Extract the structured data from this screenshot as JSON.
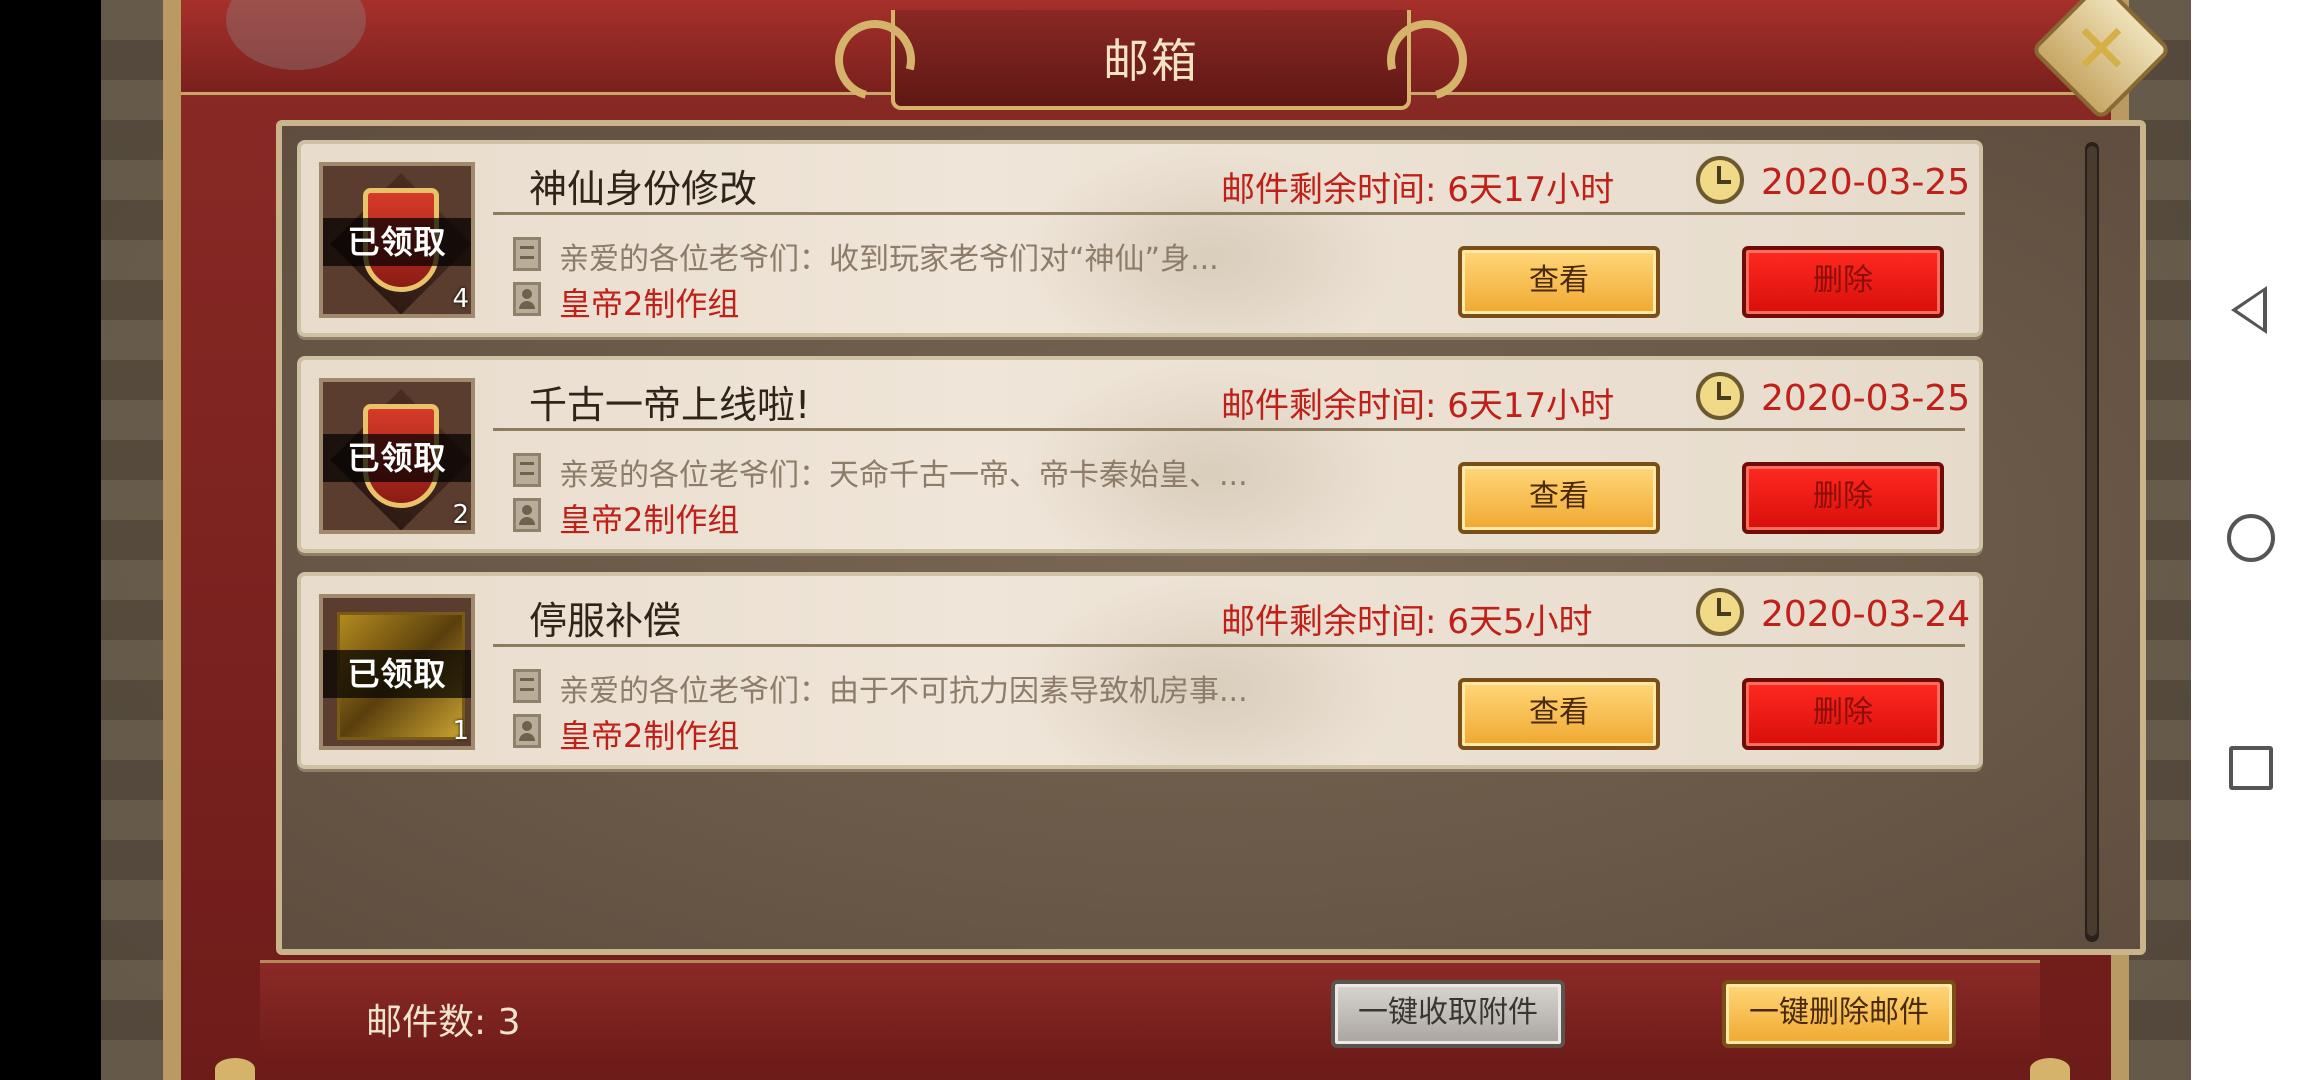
{
  "window": {
    "title": "邮箱"
  },
  "mails": [
    {
      "title": "神仙身份修改",
      "remain_label": "邮件剩余时间: 6天17小时",
      "date": "2020-03-25",
      "preview": "亲爱的各位老爷们：收到玩家老爷们对“神仙”身...",
      "sender": "皇帝2制作组",
      "claimed": "已领取",
      "count": "4",
      "thumb": "shield",
      "view_label": "查看",
      "delete_label": "删除"
    },
    {
      "title": "千古一帝上线啦!",
      "remain_label": "邮件剩余时间: 6天17小时",
      "date": "2020-03-25",
      "preview": "亲爱的各位老爷们：天命千古一帝、帝卡秦始皇、...",
      "sender": "皇帝2制作组",
      "claimed": "已领取",
      "count": "2",
      "thumb": "shield",
      "view_label": "查看",
      "delete_label": "删除"
    },
    {
      "title": "停服补偿",
      "remain_label": "邮件剩余时间: 6天5小时",
      "date": "2020-03-24",
      "preview": "亲爱的各位老爷们：由于不可抗力因素导致机房事...",
      "sender": "皇帝2制作组",
      "claimed": "已领取",
      "count": "1",
      "thumb": "treasure",
      "view_label": "查看",
      "delete_label": "删除"
    }
  ],
  "footer": {
    "count_label": "邮件数: 3",
    "collect_all_label": "一键收取附件",
    "delete_all_label": "一键删除邮件"
  },
  "colors": {
    "accent_red": "#c0201a",
    "view_button": "#f0a830",
    "delete_button": "#d80e0a"
  },
  "icons": [
    "close-icon",
    "clock-icon",
    "document-icon",
    "person-icon",
    "back-icon",
    "home-icon",
    "recents-icon"
  ]
}
